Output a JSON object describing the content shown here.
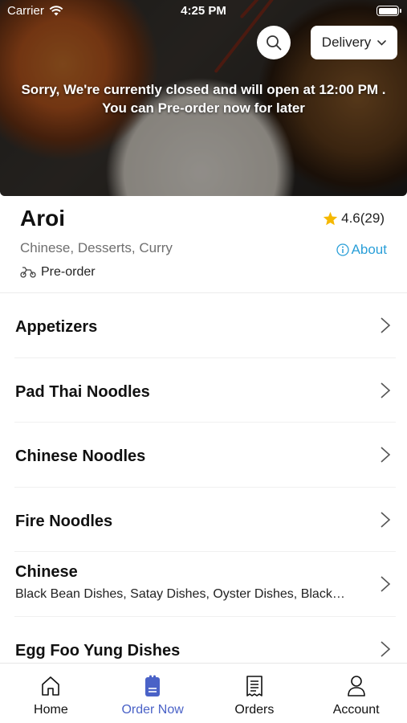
{
  "status_bar": {
    "carrier": "Carrier",
    "time": "4:25 PM"
  },
  "header": {
    "delivery_label": "Delivery"
  },
  "closed_message": {
    "line1": "Sorry, We're currently closed and will open at 12:00 PM .",
    "line2": "You can Pre-order now for later"
  },
  "restaurant": {
    "name": "Aroi",
    "rating": "4.6(29)",
    "cuisines": "Chinese, Desserts, Curry",
    "about_label": "About",
    "order_mode": "Pre-order"
  },
  "menu": [
    {
      "title": "Appetizers",
      "subtitle": ""
    },
    {
      "title": "Pad Thai Noodles",
      "subtitle": ""
    },
    {
      "title": "Chinese Noodles",
      "subtitle": ""
    },
    {
      "title": "Fire Noodles",
      "subtitle": ""
    },
    {
      "title": "Chinese",
      "subtitle": "Black Bean Dishes, Satay Dishes, Oyster Dishes, Black…"
    },
    {
      "title": "Egg Foo Yung Dishes",
      "subtitle": ""
    }
  ],
  "tabs": [
    {
      "label": "Home",
      "icon": "home-icon"
    },
    {
      "label": "Order Now",
      "icon": "order-icon",
      "active": true
    },
    {
      "label": "Orders",
      "icon": "receipt-icon"
    },
    {
      "label": "Account",
      "icon": "person-icon"
    }
  ],
  "colors": {
    "accent": "#4a62c7",
    "link": "#2a9fd8",
    "star": "#f5b800"
  }
}
